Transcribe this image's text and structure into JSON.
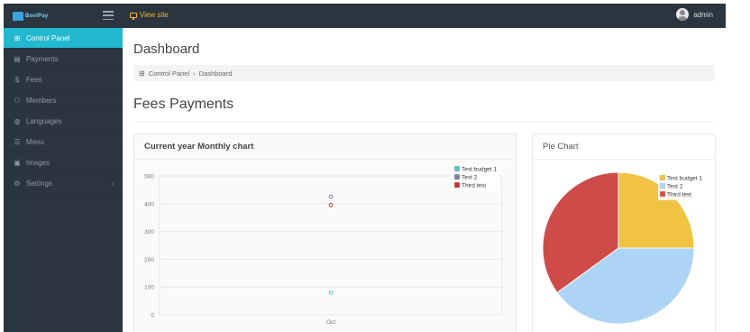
{
  "topbar": {
    "logo_text": "BoolPay",
    "view_site_label": "View site",
    "user_name": "admin"
  },
  "sidebar": {
    "items": [
      {
        "label": "Control Panel",
        "icon": "grid-icon",
        "glyph": "⊞",
        "active": true
      },
      {
        "label": "Payments",
        "icon": "document-icon",
        "glyph": "▤"
      },
      {
        "label": "Fees",
        "icon": "dollar-icon",
        "glyph": "$"
      },
      {
        "label": "Members",
        "icon": "users-icon",
        "glyph": "⚇"
      },
      {
        "label": "Languages",
        "icon": "globe-icon",
        "glyph": "◍"
      },
      {
        "label": "Menu",
        "icon": "menu-icon",
        "glyph": "☰"
      },
      {
        "label": "Images",
        "icon": "image-icon",
        "glyph": "▣"
      },
      {
        "label": "Settings",
        "icon": "gear-icon",
        "glyph": "⚙",
        "chevron": "‹"
      }
    ]
  },
  "main": {
    "title": "Dashboard",
    "breadcrumb": {
      "root": "Control Panel",
      "separator": "›",
      "current": "Dashboard"
    },
    "section_title": "Fees Payments",
    "bar_card_title": "Current year Monthly chart",
    "pie_card_title": "Pie Chart"
  },
  "colors": {
    "accent": "#22b8cf",
    "sidebar_bg": "#2a3540",
    "view_site": "#f0b429"
  },
  "chart_data": [
    {
      "type": "scatter",
      "title": "Current year Monthly chart",
      "categories": [
        "Oct"
      ],
      "ylim": [
        0,
        500
      ],
      "yticks": [
        0,
        100,
        200,
        300,
        400,
        500
      ],
      "grid": true,
      "legend_position": "top-right",
      "series": [
        {
          "name": "Test budget 1",
          "color": "#5bc0c8",
          "values": [
            80
          ]
        },
        {
          "name": "Test 2",
          "color": "#7f7f9f",
          "values": [
            425
          ]
        },
        {
          "name": "Third test",
          "color": "#c9302c",
          "values": [
            395
          ]
        }
      ]
    },
    {
      "type": "pie",
      "title": "Pie Chart",
      "legend_position": "top-right",
      "labels": [
        "Test budget 1",
        "Test 2",
        "Third test"
      ],
      "values": [
        25,
        40,
        35
      ],
      "colors": [
        "#f0c342",
        "#aed4f5",
        "#cf4b48"
      ]
    }
  ]
}
